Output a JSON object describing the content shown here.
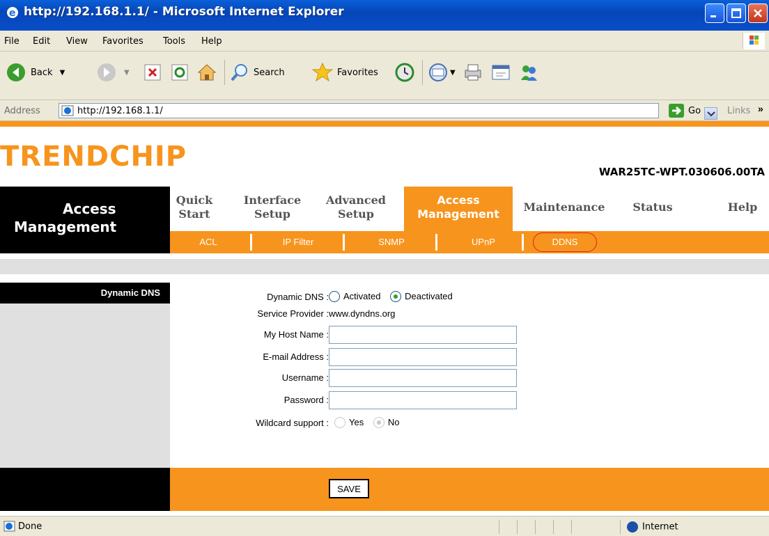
{
  "window": {
    "title": "http://192.168.1.1/ - Microsoft Internet Explorer"
  },
  "menu": [
    "File",
    "Edit",
    "View",
    "Favorites",
    "Tools",
    "Help"
  ],
  "toolbar": {
    "back": "Back",
    "search": "Search",
    "favorites": "Favorites"
  },
  "address": {
    "label": "Address",
    "url": "http://192.168.1.1/",
    "go": "Go",
    "links": "Links"
  },
  "page": {
    "brand": "TRENDCHIP",
    "model": "WAR25TC-WPT.030606.00TA",
    "section_line1": "Access",
    "section_line2": "Management",
    "nav": [
      {
        "line1": "Quick",
        "line2": "Start"
      },
      {
        "line1": "Interface",
        "line2": "Setup"
      },
      {
        "line1": "Advanced",
        "line2": "Setup"
      },
      {
        "line1": "Access",
        "line2": "Management"
      },
      {
        "line1": "Maintenance",
        "line2": ""
      },
      {
        "line1": "Status",
        "line2": ""
      },
      {
        "line1": "Help",
        "line2": ""
      }
    ],
    "subnav": [
      "ACL",
      "IP Filter",
      "SNMP",
      "UPnP",
      "DDNS"
    ],
    "sidebar_title": "Dynamic DNS",
    "form": {
      "dynamic_dns_label": "Dynamic DNS :",
      "activated": "Activated",
      "deactivated": "Deactivated",
      "service_provider_label": "Service Provider :",
      "service_provider_value": "www.dyndns.org",
      "host_name_label": "My Host Name :",
      "email_label": "E-mail Address :",
      "username_label": "Username :",
      "password_label": "Password :",
      "wildcard_label": "Wildcard support :",
      "yes": "Yes",
      "no": "No",
      "host_name_value": "",
      "email_value": "",
      "username_value": "",
      "password_value": ""
    },
    "save": "SAVE"
  },
  "status": {
    "text": "Done",
    "zone": "Internet"
  },
  "colors": {
    "accent": "#f7941d",
    "titlebar": "#0a5fd8",
    "ddns_outline": "#dd2222"
  }
}
